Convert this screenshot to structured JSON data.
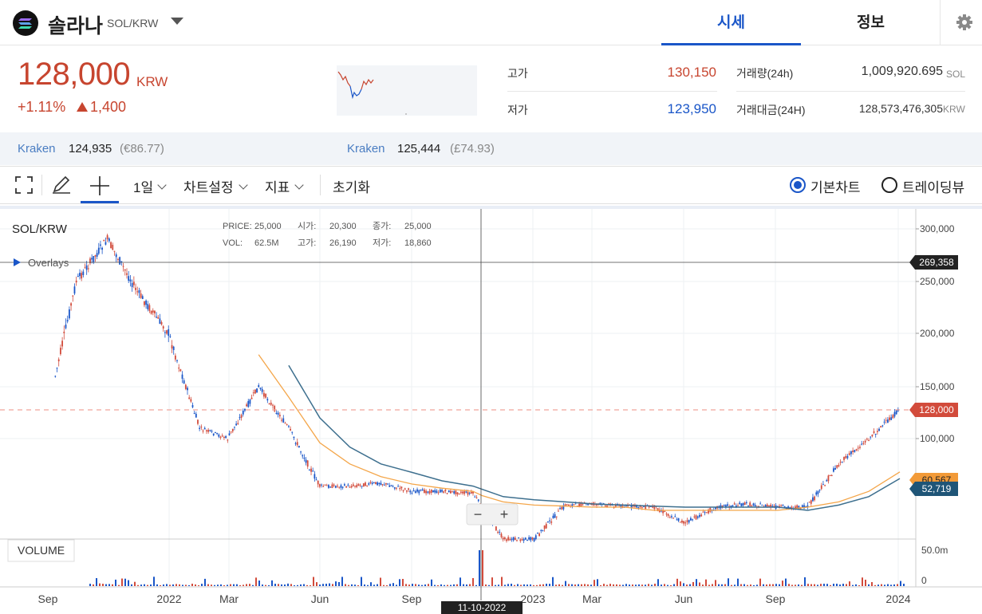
{
  "header": {
    "coin_name": "솔라나",
    "pair": "SOL/KRW",
    "tabs": [
      "시세",
      "정보"
    ],
    "logo_icon": "solana-logo",
    "settings_icon": "gear-icon"
  },
  "price": {
    "current": "128,000",
    "unit": "KRW",
    "change_pct": "+1.11%",
    "change_abs": "1,400",
    "color_up": "#c7452f",
    "color_down": "#1a56c8"
  },
  "stats": {
    "high_label": "고가",
    "high_value": "130,150",
    "low_label": "저가",
    "low_value": "123,950",
    "volume_label": "거래량(24h)",
    "volume_value": "1,009,920.695",
    "volume_unit": "SOL",
    "amount_label": "거래대금(24H)",
    "amount_value": "128,573,476,305",
    "amount_unit": "KRW"
  },
  "exchanges": [
    {
      "name": "Kraken",
      "value": "124,935",
      "sub": "(€86.77)"
    },
    {
      "name": "Kraken",
      "value": "125,444",
      "sub": "(£74.93)"
    }
  ],
  "toolbar": {
    "interval": "1일",
    "chart_settings": "차트설정",
    "indicators": "지표",
    "reset": "초기화",
    "basic_chart": "기본차트",
    "tradingview": "트레이딩뷰",
    "selected_view": "기본차트"
  },
  "chart": {
    "symbol": "SOL/KRW",
    "overlays_label": "Overlays",
    "volume_label": "VOLUME",
    "ohlc": {
      "price_label": "PRICE:",
      "price": "25,000",
      "open_label": "시가:",
      "open": "20,300",
      "close_label": "종가:",
      "close": "25,000",
      "vol_label": "VOL:",
      "vol": "62.5M",
      "high_label": "고가:",
      "high": "26,190",
      "low_label": "저가:",
      "low": "18,860"
    },
    "y_ticks": [
      "300,000",
      "250,000",
      "200,000",
      "150,000",
      "100,000"
    ],
    "vol_ticks": [
      "50.0m",
      "0"
    ],
    "x_ticks": [
      "Sep",
      "2022",
      "Mar",
      "Jun",
      "Sep",
      "2023",
      "Mar",
      "Jun",
      "Sep",
      "2024"
    ],
    "crosshair_price": "269,358",
    "last_price_tag": "128,000",
    "ma_long_tag": "60,567",
    "ma_short_tag": "52,719",
    "crosshair_date": "11-10-2022",
    "zoom_out": "−",
    "zoom_in": "+"
  },
  "chart_data": {
    "type": "line",
    "x": [
      "2021-09-10",
      "2021-10-01",
      "2021-11-01",
      "2021-12-01",
      "2022-01-01",
      "2022-02-01",
      "2022-03-01",
      "2022-04-01",
      "2022-05-01",
      "2022-06-01",
      "2022-07-01",
      "2022-08-01",
      "2022-09-01",
      "2022-10-01",
      "2022-11-01",
      "2022-11-10",
      "2022-12-01",
      "2023-01-01",
      "2023-02-01",
      "2023-03-01",
      "2023-04-01",
      "2023-05-01",
      "2023-06-01",
      "2023-07-01",
      "2023-08-01",
      "2023-09-01",
      "2023-10-01",
      "2023-11-01",
      "2023-12-01",
      "2024-01-01"
    ],
    "series": [
      {
        "name": "SOL/KRW",
        "values": [
          160000,
          250000,
          290000,
          240000,
          200000,
          110000,
          100000,
          150000,
          110000,
          45000,
          45000,
          48000,
          40000,
          40000,
          38000,
          25000,
          15000,
          15000,
          27000,
          28000,
          26000,
          25000,
          20000,
          25000,
          28000,
          25000,
          25000,
          70000,
          100000,
          128000
        ]
      },
      {
        "name": "",
        "values": [
          null,
          null,
          null,
          null,
          null,
          null,
          null,
          180000,
          140000,
          95000,
          70000,
          55000,
          47000,
          43000,
          40000,
          36000,
          30000,
          27000,
          26000,
          25000,
          25000,
          24000,
          24000,
          24000,
          24000,
          24000,
          25000,
          30000,
          40000,
          60567
        ]
      },
      {
        "name": "",
        "values": [
          null,
          null,
          null,
          null,
          null,
          null,
          null,
          null,
          170000,
          120000,
          90000,
          70000,
          60000,
          50000,
          45000,
          42000,
          35000,
          32000,
          30000,
          28000,
          27000,
          26000,
          25000,
          25000,
          25000,
          25000,
          24000,
          27000,
          35000,
          52719
        ]
      }
    ],
    "ylabel": "",
    "ylim": [
      0,
      320000
    ],
    "y_ticks": [
      100000,
      150000,
      200000,
      250000,
      300000
    ],
    "grid": true
  }
}
